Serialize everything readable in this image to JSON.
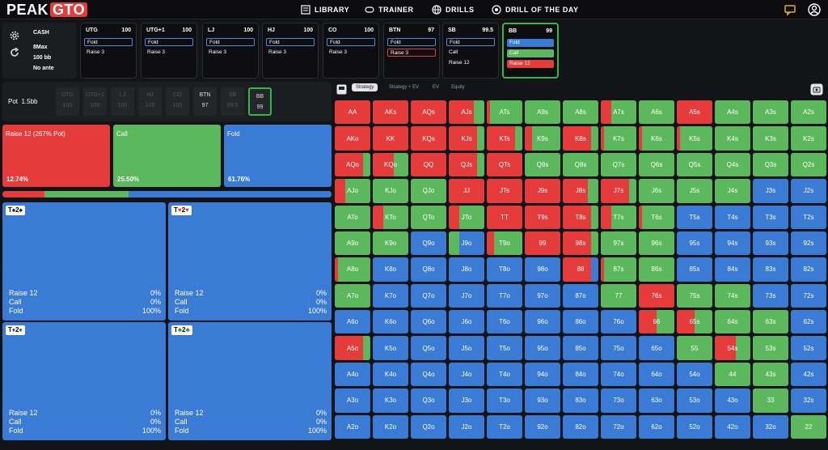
{
  "nav": {
    "logo_a": "PEAK",
    "logo_b": "GTO",
    "items": [
      "LIBRARY",
      "TRAINER",
      "DRILLS",
      "DRILL OF THE DAY"
    ]
  },
  "settings": {
    "game": "CASH",
    "format": "8Max",
    "stack": "100 bb",
    "ante": "No ante"
  },
  "positions": [
    {
      "name": "UTG",
      "stack": "100",
      "acts": [
        "Fold",
        "Raise 3"
      ]
    },
    {
      "name": "UTG+1",
      "stack": "100",
      "acts": [
        "Fold",
        "Raise 3"
      ]
    },
    {
      "name": "LJ",
      "stack": "100",
      "acts": [
        "Fold",
        "Raise 3"
      ]
    },
    {
      "name": "HJ",
      "stack": "100",
      "acts": [
        "Fold",
        "Raise 3"
      ]
    },
    {
      "name": "CO",
      "stack": "100",
      "acts": [
        "Fold",
        "Raise 3"
      ]
    },
    {
      "name": "BTN",
      "stack": "97",
      "acts": [
        "Fold",
        "Raise 3"
      ]
    },
    {
      "name": "SB",
      "stack": "99.5",
      "acts": [
        "Fold",
        "Call",
        "Raise 12"
      ]
    },
    {
      "name": "BB",
      "stack": "99",
      "acts": [
        "Fold",
        "Call",
        "Raise 12"
      ]
    }
  ],
  "pot": {
    "label": "Pot",
    "value": "1.5bb"
  },
  "seats": [
    {
      "name": "UTG",
      "stack": "100"
    },
    {
      "name": "UTG+1",
      "stack": "100"
    },
    {
      "name": "LJ",
      "stack": "100"
    },
    {
      "name": "HJ",
      "stack": "100"
    },
    {
      "name": "CO",
      "stack": "100"
    },
    {
      "name": "BTN",
      "stack": "97"
    },
    {
      "name": "SB",
      "stack": "99.5"
    },
    {
      "name": "BB",
      "stack": "99"
    }
  ],
  "summary": [
    {
      "label": "Raise 12 (267% Pot)",
      "pct": "12.74%",
      "frac": 0.1274
    },
    {
      "label": "Call",
      "pct": "25.50%",
      "frac": 0.255
    },
    {
      "label": "Fold",
      "pct": "61.76%",
      "frac": 0.6176
    }
  ],
  "combos": [
    {
      "r1": "T",
      "s1": "♠",
      "c1": "k",
      "r2": "2",
      "s2": "♠",
      "c2": "k",
      "rows": [
        [
          "Raise 12",
          "0%"
        ],
        [
          "Call",
          "0%"
        ],
        [
          "Fold",
          "100%"
        ]
      ]
    },
    {
      "r1": "T",
      "s1": "♥",
      "c1": "r",
      "r2": "2",
      "s2": "♥",
      "c2": "r",
      "rows": [
        [
          "Raise 12",
          "0%"
        ],
        [
          "Call",
          "0%"
        ],
        [
          "Fold",
          "100%"
        ]
      ]
    },
    {
      "r1": "T",
      "s1": "♦",
      "c1": "b",
      "r2": "2",
      "s2": "♦",
      "c2": "b",
      "rows": [
        [
          "Raise 12",
          "0%"
        ],
        [
          "Call",
          "0%"
        ],
        [
          "Fold",
          "100%"
        ]
      ]
    },
    {
      "r1": "T",
      "s1": "♣",
      "c1": "g",
      "r2": "2",
      "s2": "♣",
      "c2": "g",
      "rows": [
        [
          "Raise 12",
          "0%"
        ],
        [
          "Call",
          "0%"
        ],
        [
          "Fold",
          "100%"
        ]
      ]
    }
  ],
  "tabs": [
    "Strategy",
    "Strategy + EV",
    "EV",
    "Equity"
  ],
  "colors": {
    "raise": "#e53b3b",
    "call": "#5cb85c",
    "fold": "#3a7bd5",
    "active": "#2eb84a"
  },
  "grid": [
    [
      [
        "AA",
        1,
        0
      ],
      [
        "AKs",
        1,
        0
      ],
      [
        "AQs",
        1,
        0
      ],
      [
        "AJs",
        0.7,
        0.3
      ],
      [
        "ATs",
        0.1,
        0.9
      ],
      [
        "A9s",
        0,
        1
      ],
      [
        "A8s",
        0,
        1
      ],
      [
        "A7s",
        0.3,
        0.7
      ],
      [
        "A6s",
        0,
        1
      ],
      [
        "A5s",
        1,
        0
      ],
      [
        "A4s",
        0,
        1
      ],
      [
        "A3s",
        0,
        1
      ],
      [
        "A2s",
        0,
        1
      ]
    ],
    [
      [
        "AKo",
        1,
        0
      ],
      [
        "KK",
        1,
        0
      ],
      [
        "KQs",
        1,
        0
      ],
      [
        "KJs",
        0.8,
        0.2
      ],
      [
        "KTs",
        0.8,
        0.2
      ],
      [
        "K9s",
        0.2,
        0.8
      ],
      [
        "K8s",
        0.8,
        0.2
      ],
      [
        "K7s",
        0.1,
        0.9
      ],
      [
        "K6s",
        0.1,
        0.9
      ],
      [
        "K5s",
        0.1,
        0.9
      ],
      [
        "K4s",
        0,
        1
      ],
      [
        "K3s",
        0,
        1
      ],
      [
        "K2s",
        0,
        1
      ]
    ],
    [
      [
        "AQo",
        0.8,
        0.2
      ],
      [
        "KQo",
        0.6,
        0.4
      ],
      [
        "QQ",
        1,
        0
      ],
      [
        "QJs",
        0.8,
        0.2
      ],
      [
        "QTs",
        1,
        0
      ],
      [
        "Q9s",
        0,
        1
      ],
      [
        "Q8s",
        0,
        1
      ],
      [
        "Q7s",
        0,
        1
      ],
      [
        "Q6s",
        0,
        1
      ],
      [
        "Q5s",
        0,
        1
      ],
      [
        "Q4s",
        0,
        1
      ],
      [
        "Q3s",
        0,
        1
      ],
      [
        "Q2s",
        0,
        1
      ]
    ],
    [
      [
        "AJo",
        0.3,
        0.7
      ],
      [
        "KJo",
        0,
        1
      ],
      [
        "QJo",
        0,
        1
      ],
      [
        "JJ",
        1,
        0
      ],
      [
        "JTs",
        1,
        0
      ],
      [
        "J9s",
        1,
        0
      ],
      [
        "J8s",
        0.7,
        0.3
      ],
      [
        "J7s",
        0.8,
        0.2
      ],
      [
        "J6s",
        0,
        1
      ],
      [
        "J5s",
        0,
        1
      ],
      [
        "J4s",
        0,
        1
      ],
      [
        "J3s",
        0,
        0
      ],
      [
        "J2s",
        0,
        0
      ]
    ],
    [
      [
        "ATo",
        0,
        1
      ],
      [
        "KTo",
        0.3,
        0.7
      ],
      [
        "QTo",
        0,
        1
      ],
      [
        "JTo",
        0.3,
        0.7
      ],
      [
        "TT",
        1,
        0
      ],
      [
        "T9s",
        1,
        0
      ],
      [
        "T8s",
        0.8,
        0.2
      ],
      [
        "T7s",
        0.3,
        0.7
      ],
      [
        "T6s",
        0.1,
        0.9
      ],
      [
        "T5s",
        0,
        0
      ],
      [
        "T4s",
        0,
        0
      ],
      [
        "T3s",
        0,
        0
      ],
      [
        "T2s",
        0,
        0
      ]
    ],
    [
      [
        "A9o",
        0,
        1
      ],
      [
        "K9o",
        0,
        1
      ],
      [
        "Q9o",
        0,
        0
      ],
      [
        "J9o",
        0,
        0.3
      ],
      [
        "T9o",
        0.2,
        0.8
      ],
      [
        "99",
        1,
        0
      ],
      [
        "98s",
        0.8,
        0.2
      ],
      [
        "97s",
        0,
        1
      ],
      [
        "96s",
        0,
        1
      ],
      [
        "95s",
        0,
        0
      ],
      [
        "94s",
        0,
        0
      ],
      [
        "93s",
        0,
        0
      ],
      [
        "92s",
        0,
        0
      ]
    ],
    [
      [
        "A8o",
        0.1,
        0.9
      ],
      [
        "K8o",
        0,
        0
      ],
      [
        "Q8o",
        0,
        0
      ],
      [
        "J8o",
        0,
        0
      ],
      [
        "T8o",
        0,
        0
      ],
      [
        "98o",
        0,
        0
      ],
      [
        "88",
        0.8,
        0
      ],
      [
        "87s",
        0.1,
        0.9
      ],
      [
        "86s",
        0,
        1
      ],
      [
        "85s",
        0,
        0
      ],
      [
        "84s",
        0,
        0
      ],
      [
        "83s",
        0,
        0
      ],
      [
        "82s",
        0,
        0
      ]
    ],
    [
      [
        "A7o",
        0,
        1
      ],
      [
        "K7o",
        0,
        0
      ],
      [
        "Q7o",
        0,
        0
      ],
      [
        "J7o",
        0,
        0
      ],
      [
        "T7o",
        0,
        0
      ],
      [
        "97o",
        0,
        0
      ],
      [
        "87o",
        0,
        0
      ],
      [
        "77",
        0,
        1
      ],
      [
        "76s",
        1,
        0
      ],
      [
        "75s",
        0,
        1
      ],
      [
        "74s",
        0,
        1
      ],
      [
        "73s",
        0,
        0
      ],
      [
        "72s",
        0,
        0
      ]
    ],
    [
      [
        "A6o",
        0,
        0
      ],
      [
        "K6o",
        0,
        0
      ],
      [
        "Q6o",
        0,
        0
      ],
      [
        "J6o",
        0,
        0
      ],
      [
        "T6o",
        0,
        0
      ],
      [
        "96o",
        0,
        0
      ],
      [
        "86o",
        0,
        0
      ],
      [
        "76o",
        0,
        0
      ],
      [
        "66",
        0.5,
        0.5
      ],
      [
        "65s",
        0.5,
        0.5
      ],
      [
        "64s",
        0,
        1
      ],
      [
        "63s",
        0,
        1
      ],
      [
        "62s",
        0,
        0
      ]
    ],
    [
      [
        "A5o",
        0.8,
        0.2
      ],
      [
        "K5o",
        0,
        0
      ],
      [
        "Q5o",
        0,
        0
      ],
      [
        "J5o",
        0,
        0
      ],
      [
        "T5o",
        0,
        0
      ],
      [
        "95o",
        0,
        0
      ],
      [
        "85o",
        0,
        0
      ],
      [
        "75o",
        0,
        0
      ],
      [
        "65o",
        0,
        0
      ],
      [
        "55",
        0,
        1
      ],
      [
        "54s",
        0.6,
        0.4
      ],
      [
        "53s",
        0,
        1
      ],
      [
        "52s",
        0,
        0
      ]
    ],
    [
      [
        "A4o",
        0,
        0
      ],
      [
        "K4o",
        0,
        0
      ],
      [
        "Q4o",
        0,
        0
      ],
      [
        "J4o",
        0,
        0
      ],
      [
        "T4o",
        0,
        0
      ],
      [
        "94o",
        0,
        0
      ],
      [
        "84o",
        0,
        0
      ],
      [
        "74o",
        0,
        0
      ],
      [
        "64o",
        0,
        0
      ],
      [
        "54o",
        0,
        0
      ],
      [
        "44",
        0,
        1
      ],
      [
        "43s",
        0,
        1
      ],
      [
        "42s",
        0,
        0
      ]
    ],
    [
      [
        "A3o",
        0,
        0
      ],
      [
        "K3o",
        0,
        0
      ],
      [
        "Q3o",
        0,
        0
      ],
      [
        "J3o",
        0,
        0
      ],
      [
        "T3o",
        0,
        0
      ],
      [
        "93o",
        0,
        0
      ],
      [
        "83o",
        0,
        0
      ],
      [
        "73o",
        0,
        0
      ],
      [
        "63o",
        0,
        0
      ],
      [
        "53o",
        0,
        0
      ],
      [
        "43o",
        0,
        0
      ],
      [
        "33",
        0,
        1
      ],
      [
        "32s",
        0,
        0
      ]
    ],
    [
      [
        "A2o",
        0,
        0
      ],
      [
        "K2o",
        0,
        0
      ],
      [
        "Q2o",
        0,
        0
      ],
      [
        "J2o",
        0,
        0
      ],
      [
        "T2o",
        0,
        0
      ],
      [
        "92o",
        0,
        0
      ],
      [
        "82o",
        0,
        0
      ],
      [
        "72o",
        0,
        0
      ],
      [
        "62o",
        0,
        0
      ],
      [
        "52o",
        0,
        0
      ],
      [
        "42o",
        0,
        0
      ],
      [
        "32o",
        0,
        0
      ],
      [
        "22",
        0,
        1
      ]
    ]
  ]
}
